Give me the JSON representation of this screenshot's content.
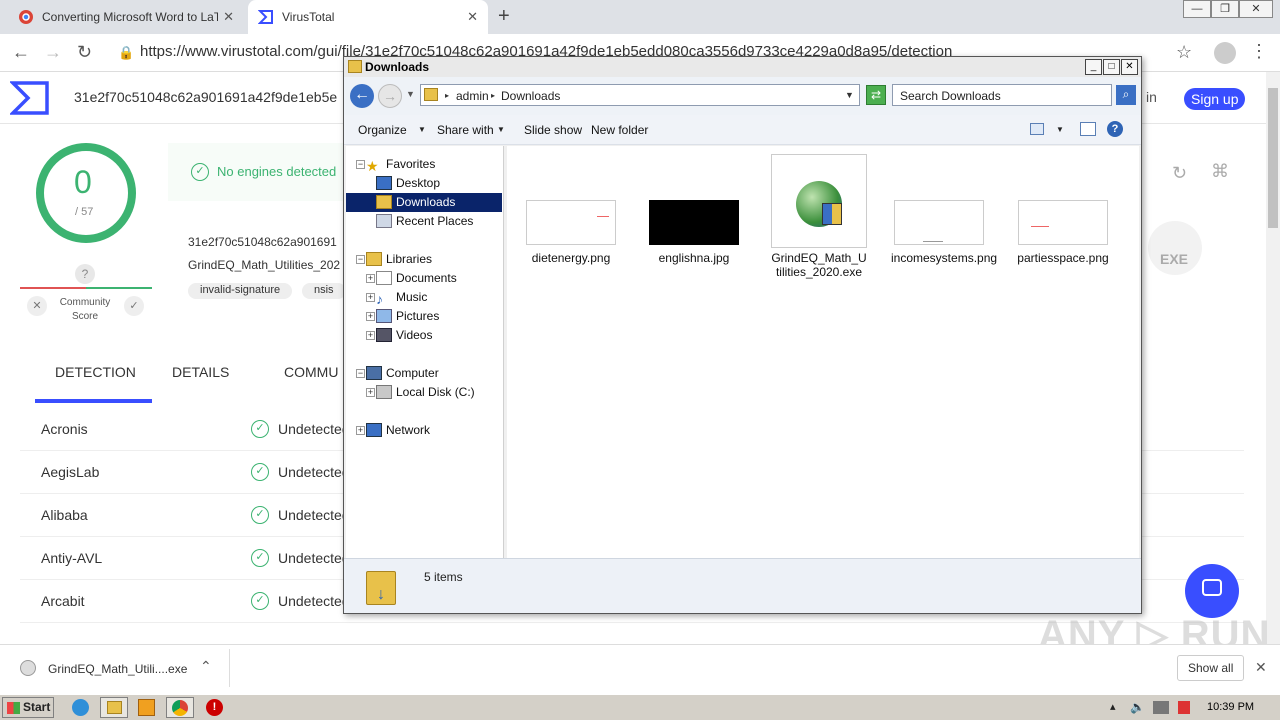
{
  "browser": {
    "tabs": [
      {
        "label": "Converting Microsoft Word to LaTeX",
        "active": false
      },
      {
        "label": "VirusTotal",
        "active": true
      }
    ],
    "url": "https://www.virustotal.com/gui/file/31e2f70c51048c62a901691a42f9de1eb5edd080ca3556d9733ce4229a0d8a95/detection"
  },
  "virustotal": {
    "hash_short": "31e2f70c51048c62a901691a42f9de1eb5e",
    "sign_in": "in",
    "sign_up": "Sign up",
    "score": "0",
    "score_total": "/ 57",
    "no_engines": "No engines detected",
    "hash_line": "31e2f70c51048c62a901691",
    "filename_short": "GrindEQ_Math_Utilities_202",
    "tags": [
      "invalid-signature",
      "nsis"
    ],
    "community_score_label": "Community Score",
    "file_type": "EXE",
    "tabs": [
      "DETECTION",
      "DETAILS",
      "COMMU"
    ],
    "detections": [
      {
        "engine": "Acronis",
        "status": "Undetected"
      },
      {
        "engine": "AegisLab",
        "status": "Undetected"
      },
      {
        "engine": "Alibaba",
        "status": "Undetected"
      },
      {
        "engine": "Antiy-AVL",
        "status": "Undetected"
      },
      {
        "engine": "Arcabit",
        "status": "Undetected"
      }
    ]
  },
  "explorer": {
    "title": "Downloads",
    "breadcrumb": [
      "admin",
      "Downloads"
    ],
    "search_placeholder": "Search Downloads",
    "commands": [
      "Organize",
      "Share with",
      "Slide show",
      "New folder"
    ],
    "nav": {
      "favorites": "Favorites",
      "desktop": "Desktop",
      "downloads": "Downloads",
      "recent": "Recent Places",
      "libraries": "Libraries",
      "documents": "Documents",
      "music": "Music",
      "pictures": "Pictures",
      "videos": "Videos",
      "computer": "Computer",
      "local_disk": "Local Disk (C:)",
      "network": "Network"
    },
    "files": [
      {
        "name": "dietenergy.png"
      },
      {
        "name": "englishna.jpg"
      },
      {
        "name": "GrindEQ_Math_Utilities_2020.exe"
      },
      {
        "name": "incomesystems.png"
      },
      {
        "name": "partiesspace.png"
      }
    ],
    "item_count": "5 items"
  },
  "download_bar": {
    "file": "GrindEQ_Math_Utili....exe",
    "show_all": "Show all"
  },
  "taskbar": {
    "start": "Start",
    "clock": "10:39 PM"
  },
  "colors": {
    "vt_blue": "#394eff",
    "vt_green": "#3cb371",
    "selection": "#0a246a"
  }
}
